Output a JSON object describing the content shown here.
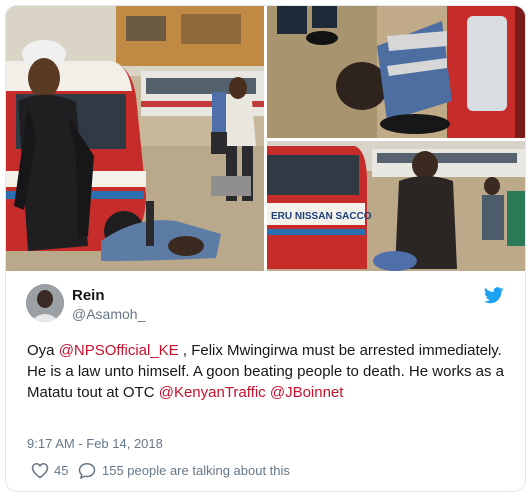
{
  "tweet": {
    "author": {
      "display_name": "Rein",
      "handle": "@Asamoh_"
    },
    "text_segments": [
      {
        "type": "text",
        "value": "Oya "
      },
      {
        "type": "mention",
        "value": "@NPSOfficial_KE"
      },
      {
        "type": "text",
        "value": " , Felix Mwingirwa must be arrested immediately. He is a law unto himself. A goon beating people to death. He works as a Matatu tout at OTC "
      },
      {
        "type": "mention",
        "value": "@KenyanTraffic"
      },
      {
        "type": "text",
        "value": " "
      },
      {
        "type": "mention",
        "value": "@JBoinnet"
      }
    ],
    "timestamp": "9:17 AM - Feb 14, 2018",
    "likes": "45",
    "talking": "155 people are talking about this",
    "sacco_sign": "ERU NISSAN SACCO"
  },
  "icons": {
    "brand": "twitter-bird-icon",
    "like": "heart-icon",
    "reply": "speech-bubble-icon"
  },
  "colors": {
    "brand_blue": "#1da1f2",
    "mention": "#c8102e",
    "secondary_text": "#657786",
    "primary_text": "#14171a"
  }
}
